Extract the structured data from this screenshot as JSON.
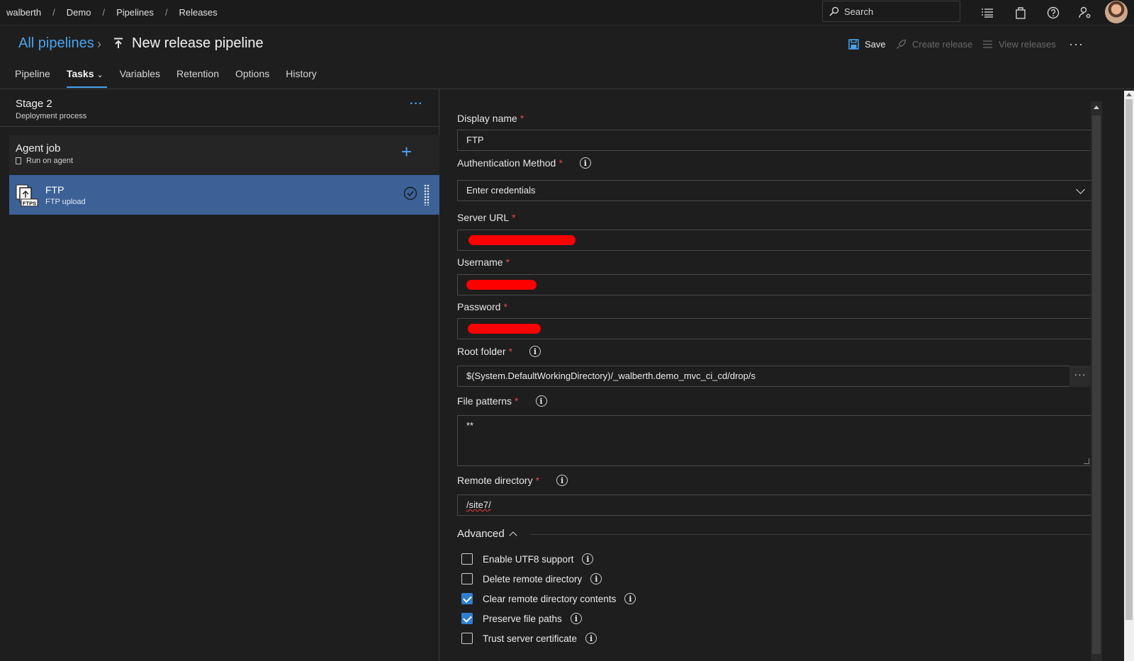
{
  "breadcrumb": [
    "walberth",
    "Demo",
    "Pipelines",
    "Releases"
  ],
  "search": {
    "label": "Search"
  },
  "header": {
    "all_pipelines": "All pipelines",
    "title": "New release pipeline",
    "save": "Save",
    "create_release": "Create release",
    "view_releases": "View releases",
    "more": "···"
  },
  "tabs": [
    {
      "label": "Pipeline"
    },
    {
      "label": "Tasks",
      "caret": "⌄"
    },
    {
      "label": "Variables"
    },
    {
      "label": "Retention"
    },
    {
      "label": "Options"
    },
    {
      "label": "History"
    }
  ],
  "stage": {
    "title": "Stage 2",
    "subtitle": "Deployment process",
    "more": "···"
  },
  "agent_job": {
    "title": "Agent job",
    "subtitle": "Run on agent",
    "add": "+"
  },
  "task": {
    "title": "FTP",
    "subtitle": "FTP upload",
    "icon_badge": "FTPS"
  },
  "form": {
    "display_name": {
      "label": "Display name",
      "value": "FTP"
    },
    "auth_method": {
      "label": "Authentication Method",
      "value": "Enter credentials"
    },
    "server_url": {
      "label": "Server URL"
    },
    "username": {
      "label": "Username"
    },
    "password": {
      "label": "Password"
    },
    "root_folder": {
      "label": "Root folder",
      "value": "$(System.DefaultWorkingDirectory)/_walberth.demo_mvc_ci_cd/drop/s",
      "browse": "···"
    },
    "file_patterns": {
      "label": "File patterns",
      "value": "**"
    },
    "remote_directory": {
      "label": "Remote directory",
      "value": "/site7/"
    },
    "required_mark": "*",
    "info_glyph": "i"
  },
  "advanced": {
    "label": "Advanced",
    "options": [
      {
        "label": "Enable UTF8 support",
        "checked": false
      },
      {
        "label": "Delete remote directory",
        "checked": false
      },
      {
        "label": "Clear remote directory contents",
        "checked": true
      },
      {
        "label": "Preserve file paths",
        "checked": true
      },
      {
        "label": "Trust server certificate",
        "checked": false
      }
    ]
  },
  "colors": {
    "accent": "#4aa3ef",
    "selected_task": "#3c6197",
    "required": "#e24b4b",
    "redaction": "#ff0000"
  }
}
